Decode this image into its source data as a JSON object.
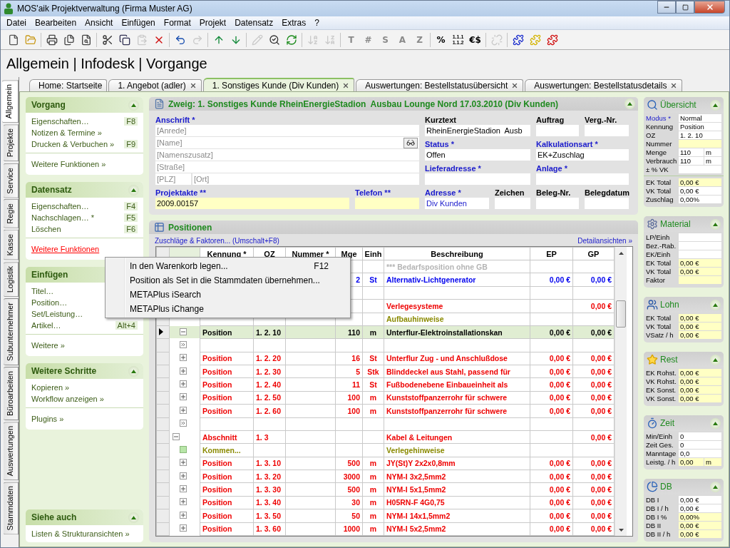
{
  "window": {
    "title": "MOS'aik Projektverwaltung (Firma Muster AG)"
  },
  "menu": [
    "Datei",
    "Bearbeiten",
    "Ansicht",
    "Einfügen",
    "Format",
    "Projekt",
    "Datensatz",
    "Extras",
    "?"
  ],
  "toolbar": [
    [
      {
        "disabled": false
      },
      {
        "disabled": false
      }
    ],
    [
      {
        "disabled": false
      },
      {
        "disabled": false
      },
      {
        "disabled": false
      }
    ],
    [
      {
        "disabled": false
      },
      {
        "disabled": false
      },
      {
        "disabled": true
      },
      {
        "disabled": false
      }
    ],
    [
      {
        "disabled": false
      },
      {
        "disabled": true
      }
    ],
    [
      {
        "disabled": false
      },
      {
        "disabled": false
      }
    ],
    [
      {
        "disabled": true
      },
      {
        "disabled": false
      },
      {
        "disabled": false
      }
    ],
    [
      {
        "disabled": true
      },
      {
        "disabled": true
      }
    ],
    [
      {
        "label": "T",
        "disabled": true
      },
      {
        "label": "#",
        "disabled": true
      },
      {
        "label": "S",
        "disabled": true
      },
      {
        "label": "A",
        "disabled": true
      },
      {
        "label": "Z",
        "disabled": true
      }
    ],
    [
      {
        "label": "%",
        "disabled": false
      },
      {
        "lines": [
          "1.1.1",
          "1.1.2"
        ],
        "disabled": false
      },
      {
        "label": "€$",
        "disabled": false
      }
    ],
    [
      {
        "disabled": true
      }
    ],
    [
      {
        "disabled": false
      },
      {
        "disabled": false
      },
      {
        "disabled": false
      }
    ]
  ],
  "heading": "Allgemein | Infodesk | Vorgange",
  "side_tabs": [
    {
      "label": "Allgemein",
      "selected": true
    },
    {
      "label": "Projekte",
      "selected": false
    },
    {
      "label": "Service",
      "selected": false
    },
    {
      "label": "Regie",
      "selected": false
    },
    {
      "label": "Kasse",
      "selected": false
    },
    {
      "label": "Logistik",
      "selected": false
    },
    {
      "label": "Subunternehmer",
      "selected": false
    },
    {
      "label": "Büroarbeiten",
      "selected": false
    },
    {
      "label": "Auswertungen",
      "selected": false
    },
    {
      "label": "Stammdaten",
      "selected": false
    }
  ],
  "doc_tabs": [
    {
      "label": "Home: Startseite",
      "selected": false,
      "closable": false
    },
    {
      "label": "1. Angebot (adler)",
      "selected": false,
      "closable": true
    },
    {
      "label": "1. Sonstiges Kunde (Div Kunden)",
      "selected": true,
      "closable": true
    },
    {
      "label": "Auswertungen: Bestellstatusübersicht",
      "selected": false,
      "closable": true
    },
    {
      "label": "Auswertungen: Bestellstatusdetails",
      "selected": false,
      "closable": true
    }
  ],
  "sidebar": [
    {
      "title": "Vorgang",
      "collapsible": true,
      "items": [
        {
          "label": "Eigenschaften…",
          "shortcut": "F8"
        },
        {
          "label": "Notizen & Termine »"
        },
        {
          "label": "Drucken & Verbuchen »",
          "shortcut": "F9"
        }
      ],
      "links": [
        {
          "label": "Weitere Funktionen »",
          "hovered": false
        }
      ]
    },
    {
      "title": "Datensatz",
      "collapsible": true,
      "items": [
        {
          "label": "Eigenschaften…",
          "shortcut": "F4"
        },
        {
          "label": "Nachschlagen… *",
          "shortcut": "F5"
        },
        {
          "label": "Löschen",
          "shortcut": "F6"
        }
      ],
      "links": [
        {
          "label": "Weitere Funktionen",
          "hovered": true
        }
      ]
    },
    {
      "title": "Einfügen",
      "items": [
        {
          "label": "Titel…"
        },
        {
          "label": "Position…"
        },
        {
          "label": "Set/Leistung…"
        },
        {
          "label": "Artikel…",
          "shortcut": "Alt+4"
        }
      ],
      "links": [
        {
          "label": "Weitere »",
          "hovered": false
        }
      ]
    },
    {
      "title": "Weitere Schritte",
      "collapsible": true,
      "items": [
        {
          "label": "Kopieren »"
        },
        {
          "label": "Workflow anzeigen »"
        }
      ],
      "links": [
        {
          "label": "Plugins »",
          "hovered": false
        }
      ]
    },
    {
      "title": "Siehe auch",
      "collapsible": true,
      "items": [
        {
          "label": "Listen & Strukturansichten »"
        }
      ]
    }
  ],
  "record": {
    "title": "Zweig: 1. Sonstiges Kunde RheinEnergieStadion  Ausbau Lounge Nord 17.03.2010 (Div Kunden)",
    "address": {
      "label": "Anschrift *",
      "lines": [
        {
          "placeholder": "[Anrede]"
        },
        {
          "placeholder": "[Name]",
          "lookup": true
        },
        {
          "placeholder": "[Namenszusatz]"
        },
        {
          "placeholder": "[Straße]"
        }
      ],
      "plz": {
        "placeholder": "[PLZ]"
      },
      "ort": {
        "placeholder": "[Ort]"
      }
    },
    "fields": [
      {
        "label": "Projektakte **",
        "required": true,
        "value": "2009.00157",
        "highlighted": true
      },
      {
        "label": "Telefon **",
        "required": true,
        "highlighted": true
      },
      {
        "label": "Kurztext",
        "required": false,
        "value": "RheinEnergieStadion  Ausb",
        "highlighted": false
      },
      {
        "label": "Auftrag",
        "required": false,
        "highlighted": false
      },
      {
        "label": "Verg.-Nr.",
        "required": false,
        "highlighted": false
      },
      {
        "label": "Status *",
        "required": true,
        "value": "Offen",
        "highlighted": false
      },
      {
        "label": "Kalkulationsart *",
        "required": true,
        "value": "EK+Zuschlag",
        "highlighted": false
      },
      {
        "label": "Lieferadresse *",
        "required": true,
        "highlighted": false
      },
      {
        "label": "Anlage *",
        "required": true,
        "highlighted": false
      },
      {
        "label": "Adresse *",
        "required": true,
        "value": "Div Kunden",
        "highlighted": false
      },
      {
        "label": "Zeichen",
        "required": false,
        "highlighted": false
      },
      {
        "label": "Beleg-Nr.",
        "required": false,
        "highlighted": false
      },
      {
        "label": "Belegdatum",
        "required": false,
        "highlighted": false
      }
    ]
  },
  "positions": {
    "title": "Positionen",
    "actions_link": "Zuschläge & Faktoren... (Umschalt+F8)",
    "details_link": "Detailansichten »",
    "columns": [
      "Kennung *",
      "OZ",
      "Nummer *",
      "Mge",
      "Einh",
      "Beschreibung",
      "EP",
      "GP"
    ],
    "rows": [
      {
        "kind": "need",
        "selected": false,
        "desc": "*** Bedarfsposition ohne GB"
      },
      {
        "kind": "alternative",
        "selected": false,
        "mge": "2",
        "einh": "St",
        "desc": "Alternativ-Lichtgenerator",
        "ep": "0,00 €",
        "gp": "0,00 €"
      },
      {
        "kind": "blank",
        "selected": false
      },
      {
        "kind": "title",
        "selected": false,
        "desc": "Verlegesysteme",
        "gp": "0,00 €"
      },
      {
        "kind": "comment",
        "selected": false,
        "desc": "Aufbauhinweise"
      },
      {
        "kind": "position",
        "selected": true,
        "toggle": {
          "kind": "minus"
        },
        "kennung": "Position",
        "oz": "1. 2. 10",
        "mge": "110",
        "einh": "m",
        "desc": "Unterflur-Elektroinstallationskan",
        "ep": "0,00 €",
        "gp": "0,00 €"
      },
      {
        "kind": "blank",
        "selected": false,
        "toggle": {
          "kind": "more"
        }
      },
      {
        "kind": "position",
        "selected": false,
        "toggle": {
          "kind": "plus"
        },
        "kennung": "Position",
        "oz": "1. 2. 20",
        "mge": "16",
        "einh": "St",
        "desc": "Unterflur Zug - und Anschlußdose",
        "ep": "0,00 €",
        "gp": "0,00 €"
      },
      {
        "kind": "position",
        "selected": false,
        "toggle": {
          "kind": "plus"
        },
        "kennung": "Position",
        "oz": "1. 2. 30",
        "mge": "5",
        "einh": "Stk",
        "desc": "Blinddeckel aus Stahl, passend für",
        "ep": "0,00 €",
        "gp": "0,00 €"
      },
      {
        "kind": "position",
        "selected": false,
        "toggle": {
          "kind": "plus"
        },
        "kennung": "Position",
        "oz": "1. 2. 40",
        "mge": "11",
        "einh": "St",
        "desc": "Fußbodenebene Einbaueinheit als",
        "ep": "0,00 €",
        "gp": "0,00 €"
      },
      {
        "kind": "position",
        "selected": false,
        "toggle": {
          "kind": "plus"
        },
        "kennung": "Position",
        "oz": "1. 2. 50",
        "mge": "100",
        "einh": "m",
        "desc": "Kunststoffpanzerrohr für schwere",
        "ep": "0,00 €",
        "gp": "0,00 €"
      },
      {
        "kind": "position",
        "selected": false,
        "toggle": {
          "kind": "plus"
        },
        "kennung": "Position",
        "oz": "1. 2. 60",
        "mge": "100",
        "einh": "m",
        "desc": "Kunststoffpanzerrohr für schwere",
        "ep": "0,00 €",
        "gp": "0,00 €"
      },
      {
        "kind": "blank",
        "selected": false,
        "toggle": {
          "kind": "more"
        }
      },
      {
        "kind": "title",
        "selected": false,
        "toggle": {
          "kind": "minus"
        },
        "kennung": "Abschnitt",
        "oz": "1. 3",
        "desc": "Kabel & Leitungen",
        "gp": "0,00 €"
      },
      {
        "kind": "comment",
        "selected": false,
        "toggle": {
          "kind": "leaf"
        },
        "kennung": "Kommen...",
        "desc": "Verlegehinweise"
      },
      {
        "kind": "position",
        "selected": false,
        "toggle": {
          "kind": "plus"
        },
        "kennung": "Position",
        "oz": "1. 3. 10",
        "mge": "500",
        "einh": "m",
        "desc": "JY(St)Y 2x2x0,8mm",
        "ep": "0,00 €",
        "gp": "0,00 €"
      },
      {
        "kind": "position",
        "selected": false,
        "toggle": {
          "kind": "plus"
        },
        "kennung": "Position",
        "oz": "1. 3. 20",
        "mge": "3000",
        "einh": "m",
        "desc": "NYM-I 3x2,5mm2",
        "ep": "0,00 €",
        "gp": "0,00 €"
      },
      {
        "kind": "position",
        "selected": false,
        "toggle": {
          "kind": "plus"
        },
        "kennung": "Position",
        "oz": "1. 3. 30",
        "mge": "500",
        "einh": "m",
        "desc": "NYM-I 5x1,5mm2",
        "ep": "0,00 €",
        "gp": "0,00 €"
      },
      {
        "kind": "position",
        "selected": false,
        "toggle": {
          "kind": "plus"
        },
        "kennung": "Position",
        "oz": "1. 3. 40",
        "mge": "30",
        "einh": "m",
        "desc": "H05RN-F 4G0,75",
        "ep": "0,00 €",
        "gp": "0,00 €"
      },
      {
        "kind": "position",
        "selected": false,
        "toggle": {
          "kind": "plus"
        },
        "kennung": "Position",
        "oz": "1. 3. 50",
        "mge": "50",
        "einh": "m",
        "desc": "NYM-I 14x1,5mm2",
        "ep": "0,00 €",
        "gp": "0,00 €"
      },
      {
        "kind": "position",
        "selected": false,
        "toggle": {
          "kind": "plus"
        },
        "kennung": "Position",
        "oz": "1. 3. 60",
        "mge": "1000",
        "einh": "m",
        "desc": "NYM-I 5x2,5mm2",
        "ep": "0,00 €",
        "gp": "0,00 €"
      }
    ]
  },
  "context_menu": [
    {
      "label": "In den Warenkorb legen...",
      "shortcut": "F12"
    },
    {
      "label": "Position als Set in die Stammdaten übernehmen..."
    },
    {
      "label": "METAPlus iSearch"
    },
    {
      "label": "METAPlus iChange"
    }
  ],
  "widgets": [
    {
      "title": "Übersicht",
      "groups": [
        [
          {
            "label": "Modus *",
            "required": true,
            "value": "Normal",
            "highlighted": false
          },
          {
            "label": "Kennung",
            "required": false,
            "value": "Position",
            "highlighted": false
          },
          {
            "label": "OZ",
            "required": false,
            "value": "1. 2. 10",
            "highlighted": false
          },
          {
            "label": "Nummer",
            "required": false,
            "highlighted": true
          },
          {
            "label": "Menge",
            "required": false,
            "value": "110",
            "unit": "m",
            "highlighted": false
          },
          {
            "label": "Verbrauch",
            "required": false,
            "value": "110",
            "unit": "m",
            "highlighted": false
          },
          {
            "label": "± % VK",
            "required": false,
            "highlighted": false
          }
        ],
        [
          {
            "label": "EK Total",
            "required": false,
            "value": "0,00 €",
            "highlighted": true
          },
          {
            "label": "VK Total",
            "required": false,
            "value": "0,00 €",
            "highlighted": false
          },
          {
            "label": "Zuschlag",
            "required": false,
            "value": "0,00%",
            "highlighted": false
          }
        ]
      ]
    },
    {
      "title": "Material",
      "groups": [
        [
          {
            "label": "LP/Einh",
            "required": false,
            "highlighted": false
          },
          {
            "label": "Bez.-Rab.",
            "required": false,
            "highlighted": false
          },
          {
            "label": "EK/Einh",
            "required": false,
            "highlighted": false
          },
          {
            "label": "EK Total",
            "required": false,
            "value": "0,00 €",
            "highlighted": true
          },
          {
            "label": "VK Total",
            "required": false,
            "value": "0,00 €",
            "highlighted": true
          },
          {
            "label": "Faktor",
            "required": false,
            "highlighted": true
          }
        ]
      ]
    },
    {
      "title": "Lohn",
      "groups": [
        [
          {
            "label": "EK Total",
            "required": false,
            "value": "0,00 €",
            "highlighted": true
          },
          {
            "label": "VK Total",
            "required": false,
            "value": "0,00 €",
            "highlighted": true
          },
          {
            "label": "VSatz / h",
            "required": false,
            "value": "0,00 €",
            "highlighted": true
          }
        ]
      ]
    },
    {
      "title": "Rest",
      "groups": [
        [
          {
            "label": "EK Rohst.",
            "required": false,
            "value": "0,00 €",
            "highlighted": true
          },
          {
            "label": "VK Rohst.",
            "required": false,
            "value": "0,00 €",
            "highlighted": true
          },
          {
            "label": "EK Sonst.",
            "required": false,
            "value": "0,00 €",
            "highlighted": true
          },
          {
            "label": "VK Sonst.",
            "required": false,
            "value": "0,00 €",
            "highlighted": true
          }
        ]
      ]
    },
    {
      "title": "Zeit",
      "groups": [
        [
          {
            "label": "Min/Einh",
            "required": false,
            "value": "0",
            "highlighted": false
          },
          {
            "label": "Zeit Ges.",
            "required": false,
            "value": "0",
            "highlighted": false
          },
          {
            "label": "Manntage",
            "required": false,
            "value": "0,0",
            "highlighted": false
          },
          {
            "label": "Leistg. / h",
            "required": false,
            "value": "0,00",
            "unit": "m",
            "highlighted": true
          }
        ]
      ]
    },
    {
      "title": "DB",
      "groups": [
        [
          {
            "label": "DB I",
            "required": false,
            "value": "0,00 €",
            "highlighted": false
          },
          {
            "label": "DB I / h",
            "required": false,
            "value": "0,00 €",
            "highlighted": false
          },
          {
            "label": "DB I %",
            "required": false,
            "value": "0,00%",
            "highlighted": true
          },
          {
            "label": "DB II",
            "required": false,
            "value": "0,00 €",
            "highlighted": true
          },
          {
            "label": "DB II / h",
            "required": false,
            "value": "0,00 €",
            "highlighted": true
          }
        ]
      ]
    }
  ]
}
